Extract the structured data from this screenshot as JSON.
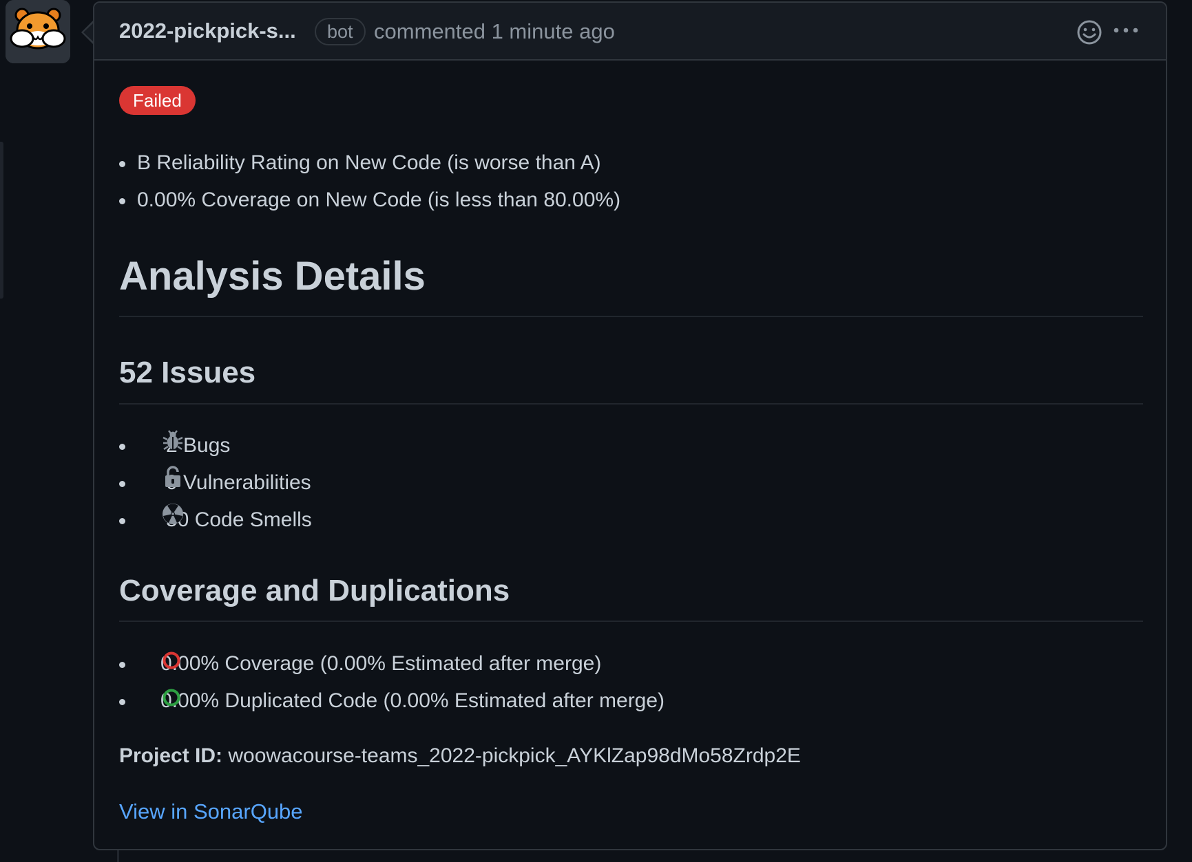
{
  "comment": {
    "author": "2022-pickpick-s...",
    "author_badge": "bot",
    "meta": "commented 1 minute ago",
    "actions": {
      "emoji_icon": "smiley-icon",
      "more_icon": "kebab-horizontal-icon"
    }
  },
  "quality_gate": {
    "status": "Failed",
    "status_color": "#da3633",
    "conditions": [
      "B Reliability Rating on New Code (is worse than A)",
      "0.00% Coverage on New Code (is less than 80.00%)"
    ]
  },
  "analysis": {
    "title": "Analysis Details",
    "issues_heading": "52 Issues",
    "issues": [
      {
        "icon": "bug-icon",
        "label": "2 Bugs"
      },
      {
        "icon": "unlocked-icon",
        "label": "0 Vulnerabilities"
      },
      {
        "icon": "radiation-icon",
        "label": "50 Code Smells"
      }
    ],
    "coverage_heading": "Coverage and Duplications",
    "coverage": [
      {
        "icon": "red-circle-icon",
        "color": "#da3633",
        "label": "0.00% Coverage (0.00% Estimated after merge)"
      },
      {
        "icon": "green-circle-icon",
        "color": "#2ea043",
        "label": "0.00% Duplicated Code (0.00% Estimated after merge)"
      }
    ],
    "project_label": "Project ID:",
    "project_id": "woowacourse-teams_2022-pickpick_AYKlZap98dMo58Zrdp2E",
    "link_text": "View in SonarQube",
    "link_color": "#58a6ff"
  }
}
